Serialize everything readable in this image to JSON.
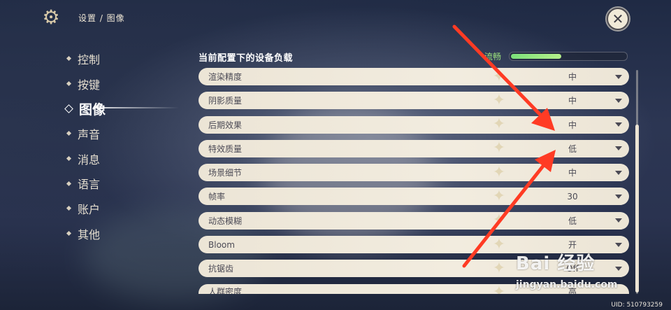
{
  "header": {
    "breadcrumb": "设置 / 图像"
  },
  "nav": {
    "items": [
      {
        "label": "控制",
        "active": false
      },
      {
        "label": "按键",
        "active": false
      },
      {
        "label": "图像",
        "active": true
      },
      {
        "label": "声音",
        "active": false
      },
      {
        "label": "消息",
        "active": false
      },
      {
        "label": "语言",
        "active": false
      },
      {
        "label": "账户",
        "active": false
      },
      {
        "label": "其他",
        "active": false
      }
    ]
  },
  "load": {
    "title": "当前配置下的设备负载",
    "status": "流畅",
    "level": 0.44,
    "color": "#8be27b"
  },
  "settings": [
    {
      "label": "渲染精度",
      "value": "中"
    },
    {
      "label": "阴影质量",
      "value": "中"
    },
    {
      "label": "后期效果",
      "value": "中"
    },
    {
      "label": "特效质量",
      "value": "低"
    },
    {
      "label": "场景细节",
      "value": "中"
    },
    {
      "label": "帧率",
      "value": "30"
    },
    {
      "label": "动态模糊",
      "value": "低"
    },
    {
      "label": "Bloom",
      "value": "开"
    },
    {
      "label": "抗锯齿",
      "value": "Off"
    },
    {
      "label": "人群密度",
      "value": "高"
    }
  ],
  "watermark": {
    "brand": "Bai  经验",
    "site": "jingyan.baidu.com"
  },
  "footer": {
    "uid": "UID: 510793259"
  },
  "colors": {
    "arrow": "#ff3b24",
    "row_bg": "#f0eadc",
    "accent": "#8be27b"
  }
}
